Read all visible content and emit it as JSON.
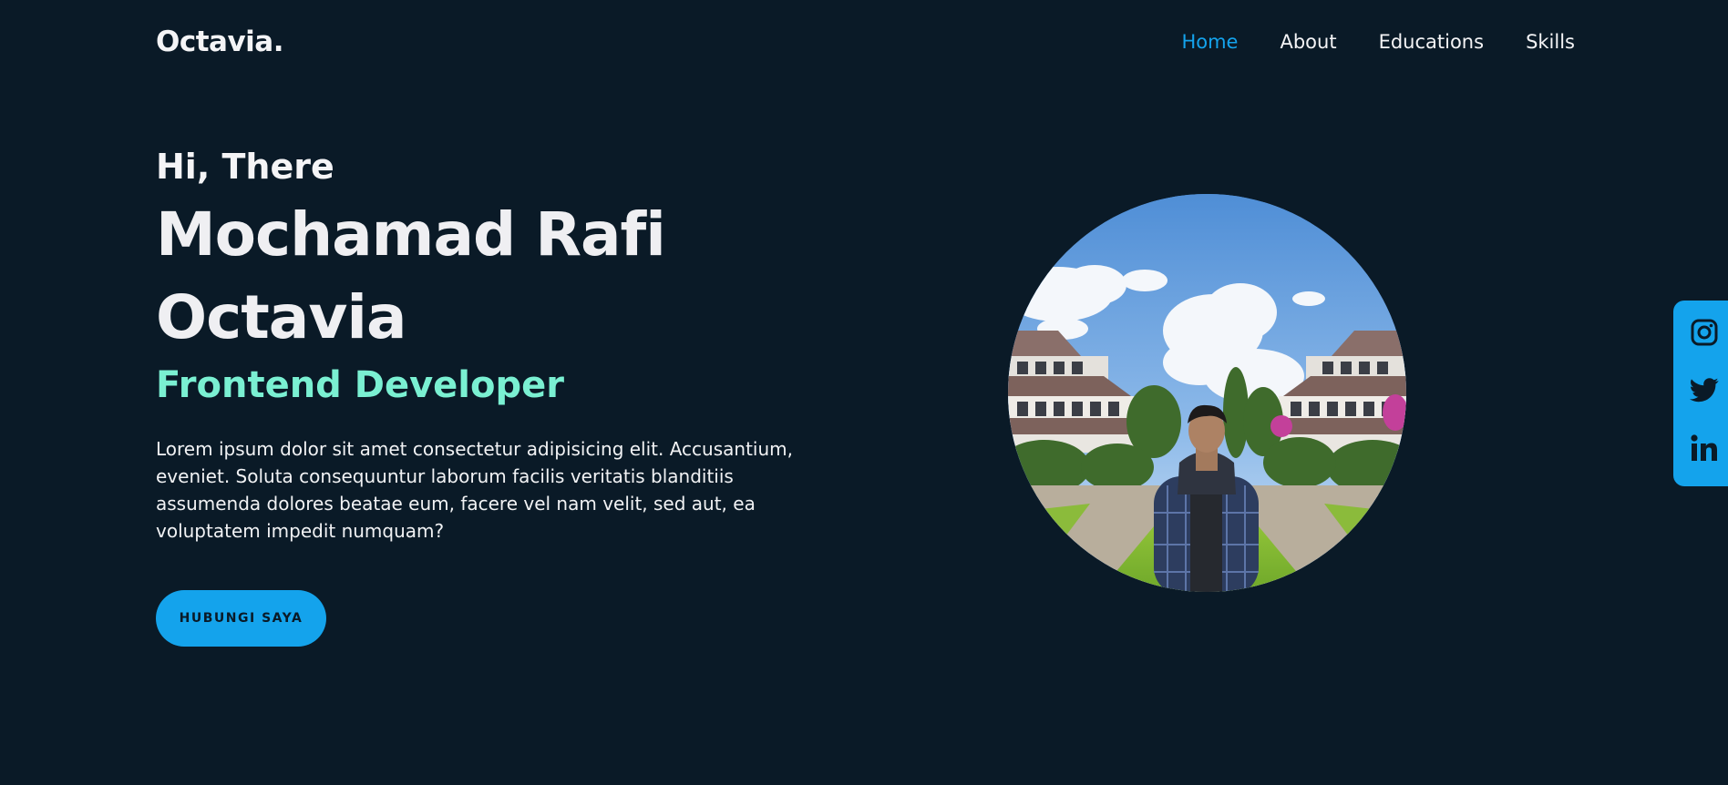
{
  "brand": {
    "logo": "Octavia."
  },
  "nav": {
    "items": [
      {
        "label": "Home",
        "active": true
      },
      {
        "label": "About",
        "active": false
      },
      {
        "label": "Educations",
        "active": false
      },
      {
        "label": "Skills",
        "active": false
      }
    ]
  },
  "hero": {
    "greeting": "Hi, There",
    "name": "Mochamad Rafi Octavia",
    "role": "Frontend Developer",
    "description": "Lorem ipsum dolor sit amet consectetur adipisicing elit. Accusantium, eveniet. Soluta consequuntur laborum facilis veritatis blanditiis assumenda dolores beatae eum, facere vel nam velit, sed aut, ea voluptatem impedit numquam?",
    "cta_label": "HUBUNGI SAYA"
  },
  "social": {
    "icons": [
      "instagram-icon",
      "twitter-icon",
      "linkedin-icon"
    ]
  },
  "colors": {
    "background": "#0a1a27",
    "accent": "#14a3ec",
    "role": "#7af0d2",
    "text": "#f1f2f4"
  }
}
